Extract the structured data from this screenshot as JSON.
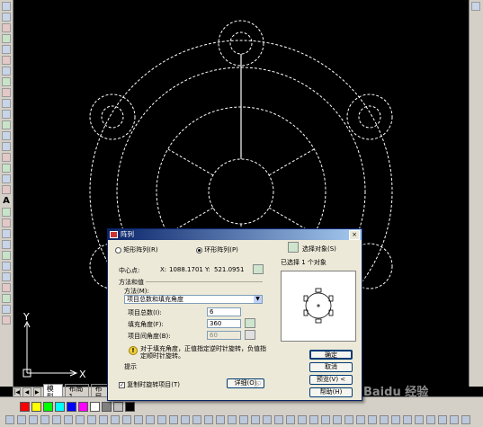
{
  "ucs": {
    "x_label": "X",
    "y_label": "Y"
  },
  "layout_tabs": [
    "模型",
    "布局1",
    "布局"
  ],
  "palette": [
    "#ff0000",
    "#ffff00",
    "#00ff00",
    "#00ffff",
    "#0000ff",
    "#ff00ff",
    "#ffffff",
    "#808080",
    "#c0c0c0",
    "#000000"
  ],
  "dialog": {
    "title": "阵列",
    "close_glyph": "×",
    "radio_rect": "矩形阵列(R)",
    "radio_polar": "环形阵列(P)",
    "select_objects_button": "选择对象(S)",
    "selected_count": "已选择 1 个对象",
    "center_label": "中心点:",
    "center_x_label": "X:",
    "center_x_value": "1088.1701",
    "center_y_label": "Y:",
    "center_y_value": "521.0951",
    "method_group": "方法和值",
    "method_label": "方法(M):",
    "method_value": "项目总数和填充角度",
    "total_items_label": "项目总数(I):",
    "total_items_value": "6",
    "fill_angle_label": "填充角度(F):",
    "fill_angle_value": "360",
    "item_angle_label": "项目间角度(B):",
    "item_angle_value": "60",
    "tip_icon": "!",
    "tip_text": "对于填充角度，正值指定逆时针旋转，负值指定顺时针旋转。",
    "tip_label": "提示",
    "rotate_checkbox": "复制时旋转项目(T)",
    "rotate_checked": true,
    "details_button": "详细(O)",
    "ok_button": "确定",
    "cancel_button": "取消",
    "preview_button": "预览(V) <",
    "help_button": "帮助(H)"
  },
  "watermark": "Baidu 经验"
}
